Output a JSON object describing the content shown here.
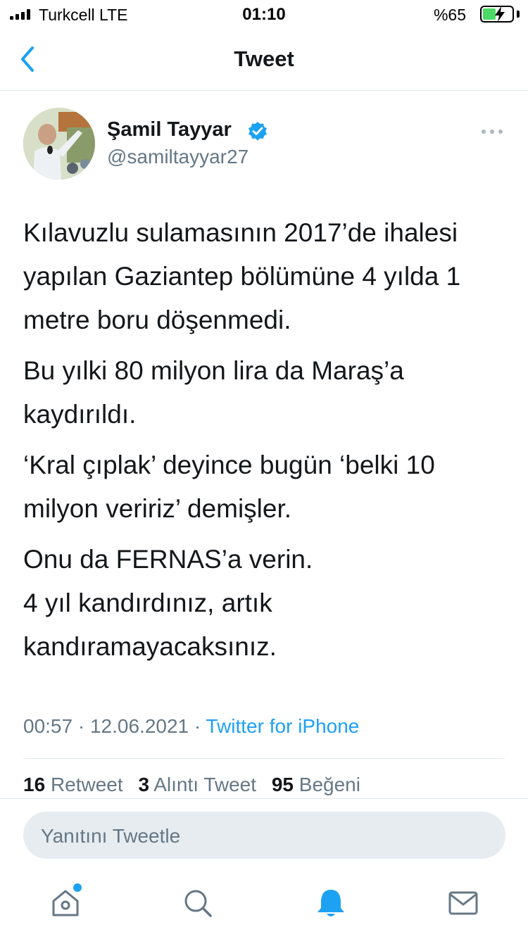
{
  "status_bar": {
    "carrier": "Turkcell  LTE",
    "time": "01:10",
    "battery": "%65",
    "battery_level_pct": 65
  },
  "nav": {
    "back_icon": "chevron-left-icon",
    "title": "Tweet"
  },
  "author": {
    "name": "Şamil Tayyar",
    "handle": "@samiltayyar27",
    "verified": true
  },
  "tweet": {
    "paragraphs": [
      "Kılavuzlu sulamasının 2017’de ihalesi yapılan Gaziantep bölümüne 4 yılda 1 metre boru döşenmedi.",
      "Bu yılki 80 milyon lira da Maraş’a kaydırıldı.",
      "‘Kral çıplak’ deyince bugün ‘belki 10 milyon veririz’ demişler.",
      "Onu da FERNAS’a verin.\n4 yıl kandırdınız, artık kandıramayacaksınız."
    ],
    "time": "00:57",
    "date": "12.06.2021",
    "separator": "·",
    "source": "Twitter for iPhone"
  },
  "stats": {
    "retweets": "16",
    "retweets_label": "Retweet",
    "quotes": "3",
    "quotes_label": "Alıntı Tweet",
    "likes": "95",
    "likes_label": "Beğeni"
  },
  "reply": {
    "placeholder": "Yanıtını Tweetle"
  },
  "tabbar": {
    "items": [
      "home-icon",
      "search-icon",
      "notifications-bell-icon",
      "messages-envelope-icon"
    ],
    "home_has_badge": true
  },
  "colors": {
    "accent": "#1da1f2",
    "text": "#14171a",
    "secondary": "#657786",
    "divider": "#e1e8ed",
    "reply_bg": "#e6ecf0"
  }
}
